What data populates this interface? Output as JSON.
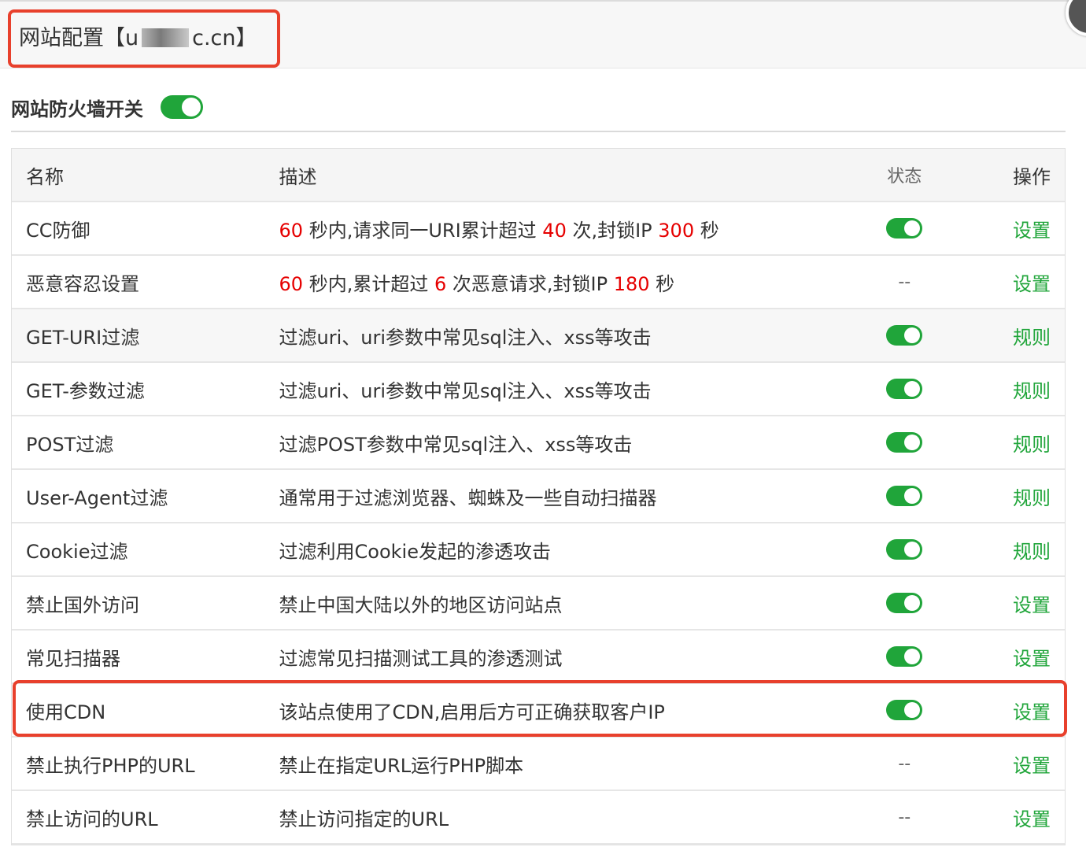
{
  "dialog": {
    "title_prefix": "网站配置【u",
    "title_suffix": "c.cn】",
    "firewall_label": "网站防火墙开关",
    "firewall_enabled": true
  },
  "table": {
    "headers": {
      "name": "名称",
      "desc": "描述",
      "status": "状态",
      "action": "操作"
    },
    "cc": {
      "name": "CC防御",
      "v1": "60",
      "t1": " 秒内,请求同一URI累计超过 ",
      "v2": "40",
      "t2": " 次,封锁IP ",
      "v3": "300",
      "t3": " 秒",
      "status": "on",
      "action": "设置"
    },
    "malice": {
      "name": "恶意容忍设置",
      "v1": "60",
      "t1": " 秒内,累计超过 ",
      "v2": "6",
      "t2": " 次恶意请求,封锁IP ",
      "v3": "180",
      "t3": " 秒",
      "status": "--",
      "action": "设置"
    },
    "rows": [
      {
        "name": "GET-URI过滤",
        "desc": "过滤uri、uri参数中常见sql注入、xss等攻击",
        "status": "on",
        "action": "规则"
      },
      {
        "name": "GET-参数过滤",
        "desc": "过滤uri、uri参数中常见sql注入、xss等攻击",
        "status": "on",
        "action": "规则"
      },
      {
        "name": "POST过滤",
        "desc": "过滤POST参数中常见sql注入、xss等攻击",
        "status": "on",
        "action": "规则"
      },
      {
        "name": "User-Agent过滤",
        "desc": "通常用于过滤浏览器、蜘蛛及一些自动扫描器",
        "status": "on",
        "action": "规则"
      },
      {
        "name": "Cookie过滤",
        "desc": "过滤利用Cookie发起的渗透攻击",
        "status": "on",
        "action": "规则"
      },
      {
        "name": "禁止国外访问",
        "desc": "禁止中国大陆以外的地区访问站点",
        "status": "on",
        "action": "设置"
      },
      {
        "name": "常见扫描器",
        "desc": "过滤常见扫描测试工具的渗透测试",
        "status": "on",
        "action": "设置"
      },
      {
        "name": "使用CDN",
        "desc": "该站点使用了CDN,启用后方可正确获取客户IP",
        "status": "on",
        "action": "设置"
      },
      {
        "name": "禁止执行PHP的URL",
        "desc": "禁止在指定URL运行PHP脚本",
        "status": "--",
        "action": "设置"
      },
      {
        "name": "禁止访问的URL",
        "desc": "禁止访问指定的URL",
        "status": "--",
        "action": "设置"
      }
    ]
  },
  "colors": {
    "accent": "#20a53a",
    "highlight": "#e8402c",
    "number": "#e60000"
  },
  "icons": {
    "close": "close-icon"
  }
}
